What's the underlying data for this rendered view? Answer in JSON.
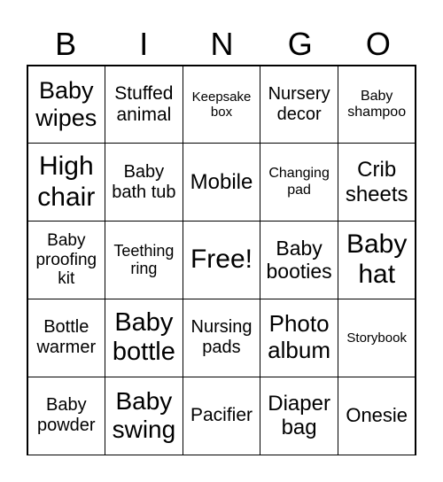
{
  "header": [
    "B",
    "I",
    "N",
    "G",
    "O"
  ],
  "cells": [
    "Baby wipes",
    "Stuffed animal",
    "Keepsake box",
    "Nursery decor",
    "Baby shampoo",
    "High chair",
    "Baby bath tub",
    "Mobile",
    "Changing pad",
    "Crib sheets",
    "Baby proofing kit",
    "Teething ring",
    "Free!",
    "Baby booties",
    "Baby hat",
    "Bottle warmer",
    "Baby bottle",
    "Nursing pads",
    "Photo album",
    "Storybook",
    "Baby powder",
    "Baby swing",
    "Pacifier",
    "Diaper bag",
    "Onesie"
  ]
}
